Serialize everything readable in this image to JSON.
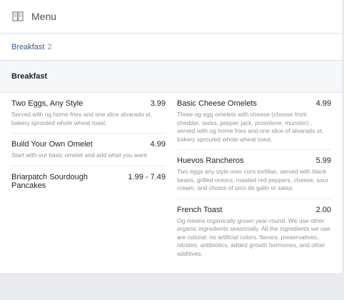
{
  "header": {
    "title": "Menu",
    "icon": "menu-book-icon"
  },
  "nav": {
    "section_label": "Breakfast",
    "section_count": "2"
  },
  "category": {
    "title": "Breakfast"
  },
  "items_left": [
    {
      "name": "Two Eggs, Any Style",
      "price": "3.99",
      "description": "Served with og home fries and one slice alvarado st. bakery sprouted whole wheat toast."
    },
    {
      "name": "Build Your Own Omelet",
      "price": "4.99",
      "description": "Start with our basic omelet and add what you want"
    },
    {
      "name": "Briarpatch Sourdough Pancakes",
      "price": "1.99 - 7.49",
      "description": ""
    }
  ],
  "items_right": [
    {
      "name": "Basic Cheese Omelets",
      "price": "4.99",
      "description": "Three og egg omelets with cheese (choose from cheddar, swiss, pepper jack, provolone, munster) , served with og home fries and one slice of alvarado st. bakery sprouted whole wheat toast."
    },
    {
      "name": "Huevos Rancheros",
      "price": "5.99",
      "description": "Two eggs any style over corn tortillas, served with black beans, grilled onions, roasted red peppers, cheese, sour cream, and choice of pico de gallo or salsa."
    },
    {
      "name": "French Toast",
      "price": "2.00",
      "description": "Og means organically grown year-round. We use other organic ingredients seasonally. All the ingredients we use are natural: no artificial colors, flavors, preservatives, nitrates, antibiotics, added growth hormones, and other additives."
    }
  ]
}
